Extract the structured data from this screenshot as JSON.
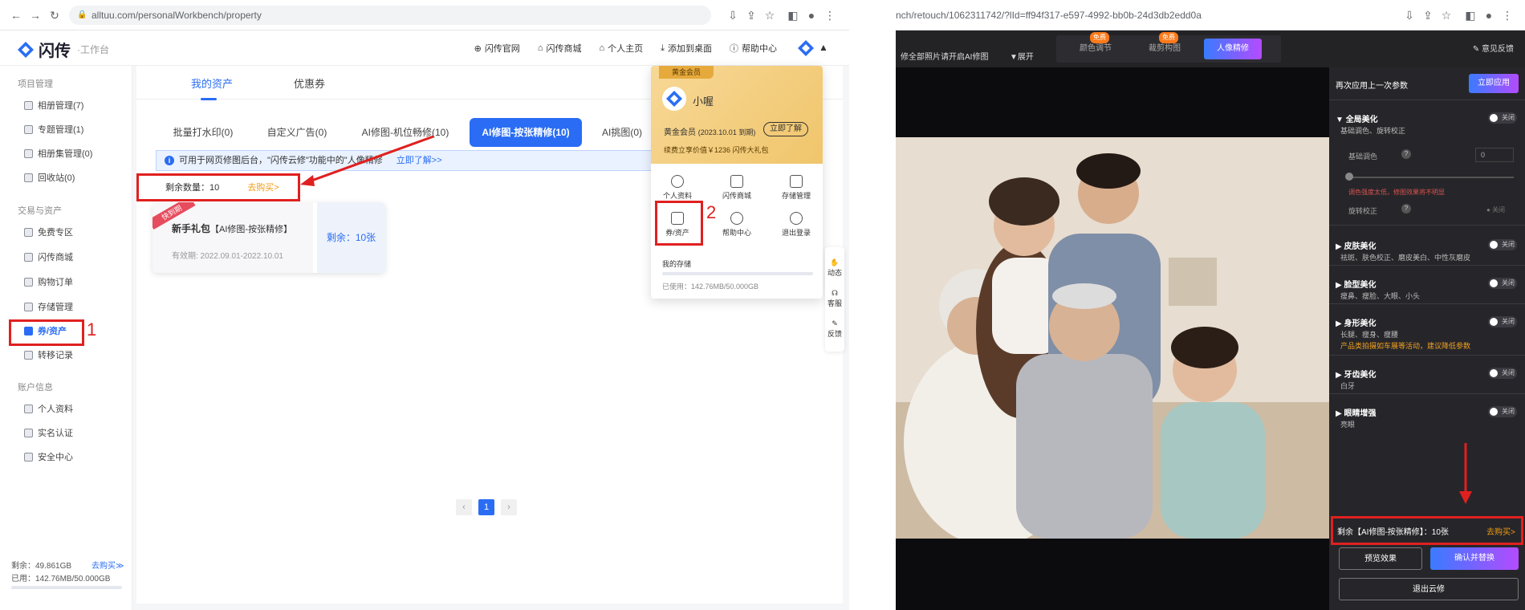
{
  "left_window": {
    "url": "alltuu.com/personalWorkbench/property",
    "logo": {
      "name": "闪传",
      "sub": "·工作台"
    },
    "topnav": [
      "闪传官网",
      "闪传商城",
      "个人主页",
      "添加到桌面",
      "帮助中心"
    ],
    "sidebar": {
      "sections": [
        {
          "title": "项目管理",
          "items": [
            "相册管理(7)",
            "专题管理(1)",
            "相册集管理(0)",
            "回收站(0)"
          ]
        },
        {
          "title": "交易与资产",
          "items": [
            "免费专区",
            "闪传商城",
            "购物订单",
            "存储管理",
            "券/资产",
            "转移记录"
          ]
        },
        {
          "title": "账户信息",
          "items": [
            "个人资料",
            "实名认证",
            "安全中心"
          ]
        }
      ],
      "storage_remaining": "剩余：49.861GB",
      "storage_buy": "去购买≫",
      "storage_used": "已用：142.76MB/50.000GB"
    },
    "main": {
      "tabs": [
        "我的资产",
        "优惠券"
      ],
      "pills": [
        "批量打水印(0)",
        "自定义广告(0)",
        "AI修图-机位畅修(10)",
        "AI修图-按张精修(10)",
        "AI挑图(0)"
      ],
      "notice": "可用于网页修图后台，\"闪传云修\"功能中的\"人像精修",
      "notice_link": "立即了解>>",
      "remaining_label": "剩余数量：10",
      "remaining_buy": "去购买>",
      "coupon": {
        "ribbon": "快到期",
        "title": "新手礼包",
        "title_sub": "【AI修图-按张精修】",
        "validity": "有效期: 2022.09.01-2022.10.01",
        "remaining": "剩余：10张"
      },
      "page": "1"
    },
    "dropdown": {
      "badge": "黄金会员",
      "username": "小喔",
      "member": "黄金会员",
      "member_expire": "(2023.10.01 到期)",
      "learn_button": "立即了解",
      "gift": "续费立享价值￥1236 闪传大礼包",
      "items": [
        "个人资料",
        "闪传商城",
        "存储管理",
        "券/资产",
        "帮助中心",
        "退出登录"
      ],
      "storage_label": "我的存储",
      "storage_used": "已使用：142.76MB/50.000GB"
    },
    "side_tools": [
      "动态",
      "客服",
      "反馈"
    ],
    "annotations": [
      "1",
      "2"
    ]
  },
  "right_window": {
    "url": "nch/retouch/1062311742/?lId=ff94f317-e597-4992-bb0b-24d3db2edd0a",
    "hint": "修全部照片请开启AI修图",
    "expand": "▼展开",
    "tabs": [
      {
        "label": "颜色调节",
        "badge": "免费"
      },
      {
        "label": "裁剪构图",
        "badge": "免费"
      },
      {
        "label": "人像精修",
        "badge": ""
      }
    ],
    "feedback": "意见反馈",
    "panel": {
      "reapply_label": "再次应用上一次参数",
      "apply_button": "立即应用",
      "sections": [
        {
          "title": "全局美化",
          "desc": "基础调色、旋转校正",
          "toggle": "关闭"
        },
        {
          "title": "皮肤美化",
          "desc": "祛斑、肤色校正、磨皮美白、中性灰磨皮",
          "toggle": "关闭"
        },
        {
          "title": "脸型美化",
          "desc": "瘦鼻、瘦脸、大眼、小头",
          "toggle": "关闭"
        },
        {
          "title": "身形美化",
          "desc": "长腿、瘦身、瘦腰",
          "toggle": "关闭"
        },
        {
          "title": "牙齿美化",
          "desc": "白牙",
          "toggle": "关闭"
        },
        {
          "title": "眼睛增强",
          "desc": "亮眼",
          "toggle": "关闭"
        }
      ],
      "basic_tone_label": "基础调色",
      "basic_tone_value": "0",
      "tone_warning": "调色强度太低，修图效果将不明显",
      "rotate_label": "旋转校正",
      "rotate_toggle": "关闭",
      "body_note": "产品类拍摄如车展等活动，建议降低参数",
      "remaining_text": "剩余【AI修图-按张精修】：10张",
      "remaining_buy": "去购买>",
      "preview_button": "预览效果",
      "confirm_button": "确认并替换",
      "exit_button": "退出云修"
    }
  },
  "colors": {
    "accent": "#2a6df4",
    "annotation": "#e02020",
    "gold": "#f0c56b",
    "dark_panel": "#26262a"
  }
}
